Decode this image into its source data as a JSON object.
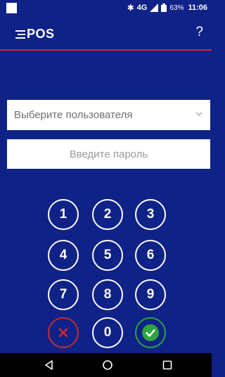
{
  "status_bar": {
    "network": "4G",
    "network_sup": "4G",
    "battery_pct": "63%",
    "time": "11:06"
  },
  "header": {
    "logo_text": "POS",
    "help": "?"
  },
  "form": {
    "user_select_value": "Выберите пользователя",
    "password_placeholder": "Введите пароль"
  },
  "keypad": {
    "keys": [
      "1",
      "2",
      "3",
      "4",
      "5",
      "6",
      "7",
      "8",
      "9"
    ],
    "zero": "0"
  },
  "colors": {
    "background": "#0f2287",
    "accent_red": "#d3252e",
    "confirm_green": "#2fa33f"
  }
}
